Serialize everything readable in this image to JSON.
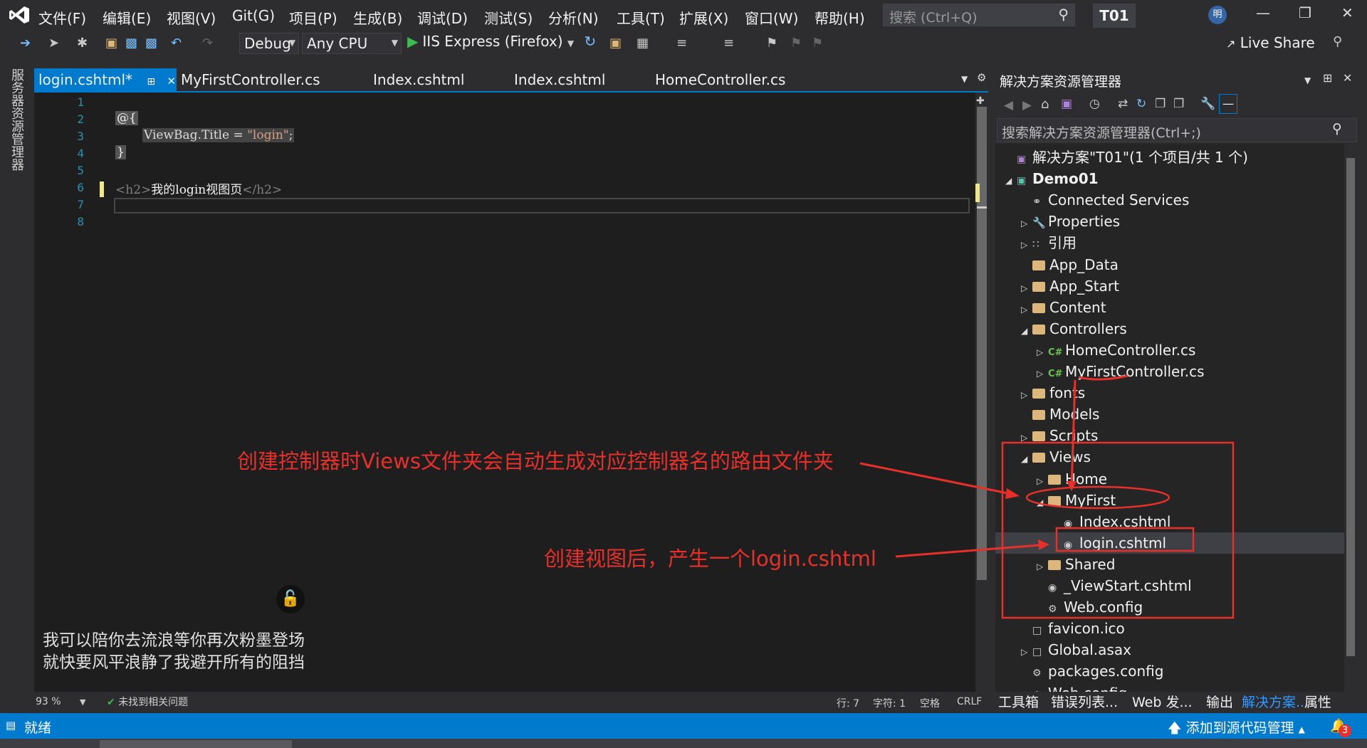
{
  "titlebar": {
    "menus": [
      "文件(F)",
      "编辑(E)",
      "视图(V)",
      "Git(G)",
      "项目(P)",
      "生成(B)",
      "调试(D)",
      "测试(S)",
      "分析(N)",
      "工具(T)",
      "扩展(X)",
      "窗口(W)",
      "帮助(H)"
    ],
    "search_placeholder": "搜索 (Ctrl+Q)",
    "solution_name": "T01",
    "avatar": "明"
  },
  "toolbar": {
    "config": "Debug",
    "platform": "Any CPU",
    "run_label": "IIS Express (Firefox)",
    "live_share": "Live Share"
  },
  "left_strip": "服务器资源管理器",
  "tabs": [
    {
      "label": "login.cshtml*",
      "active": true
    },
    {
      "label": "MyFirstController.cs"
    },
    {
      "label": "Index.cshtml"
    },
    {
      "label": "Index.cshtml"
    },
    {
      "label": "HomeController.cs"
    }
  ],
  "editor": {
    "line_numbers": [
      "1",
      "2",
      "3",
      "4",
      "5",
      "6",
      "7",
      "8"
    ],
    "code": {
      "l2": "@{",
      "l3_a": "ViewBag.Title = ",
      "l3_b": "\"login\"",
      "l3_c": ";",
      "l4": "}",
      "l6_a": "<h2>",
      "l6_b": "我的login视图页",
      "l6_c": "</h2>"
    },
    "zoom": "93 %",
    "issues": "未找到相关问题",
    "row": "行: 7",
    "col": "字符: 1",
    "spaces": "空格",
    "eol": "CRLF"
  },
  "solution_explorer": {
    "title": "解决方案资源管理器",
    "search_placeholder": "搜索解决方案资源管理器(Ctrl+;)",
    "tree": [
      {
        "label": "解决方案\"T01\"(1 个项目/共 1 个)",
        "depth": 0,
        "icon": "solution",
        "arrow": ""
      },
      {
        "label": "Demo01",
        "depth": 0,
        "icon": "project",
        "arrow": "open",
        "bold": true
      },
      {
        "label": "Connected Services",
        "depth": 1,
        "icon": "service",
        "arrow": ""
      },
      {
        "label": "Properties",
        "depth": 1,
        "icon": "wrench",
        "arrow": "closed"
      },
      {
        "label": "引用",
        "depth": 1,
        "icon": "ref",
        "arrow": "closed"
      },
      {
        "label": "App_Data",
        "depth": 1,
        "icon": "folder",
        "arrow": ""
      },
      {
        "label": "App_Start",
        "depth": 1,
        "icon": "folder",
        "arrow": "closed"
      },
      {
        "label": "Content",
        "depth": 1,
        "icon": "folder",
        "arrow": "closed"
      },
      {
        "label": "Controllers",
        "depth": 1,
        "icon": "folder",
        "arrow": "open"
      },
      {
        "label": "HomeController.cs",
        "depth": 2,
        "icon": "cs",
        "arrow": "closed"
      },
      {
        "label": "MyFirstController.cs",
        "depth": 2,
        "icon": "cs",
        "arrow": "closed"
      },
      {
        "label": "fonts",
        "depth": 1,
        "icon": "folder",
        "arrow": "closed"
      },
      {
        "label": "Models",
        "depth": 1,
        "icon": "folder",
        "arrow": ""
      },
      {
        "label": "Scripts",
        "depth": 1,
        "icon": "folder",
        "arrow": "closed"
      },
      {
        "label": "Views",
        "depth": 1,
        "icon": "folder",
        "arrow": "open"
      },
      {
        "label": "Home",
        "depth": 2,
        "icon": "folder",
        "arrow": "closed"
      },
      {
        "label": "MyFirst",
        "depth": 2,
        "icon": "folder",
        "arrow": "open"
      },
      {
        "label": "Index.cshtml",
        "depth": 3,
        "icon": "cshtml",
        "arrow": ""
      },
      {
        "label": "login.cshtml",
        "depth": 3,
        "icon": "cshtml",
        "arrow": "",
        "selected": true
      },
      {
        "label": "Shared",
        "depth": 2,
        "icon": "folder",
        "arrow": "closed"
      },
      {
        "label": "_ViewStart.cshtml",
        "depth": 2,
        "icon": "cshtml",
        "arrow": ""
      },
      {
        "label": "Web.config",
        "depth": 2,
        "icon": "config",
        "arrow": ""
      },
      {
        "label": "favicon.ico",
        "depth": 1,
        "icon": "file",
        "arrow": ""
      },
      {
        "label": "Global.asax",
        "depth": 1,
        "icon": "file",
        "arrow": "closed"
      },
      {
        "label": "packages.config",
        "depth": 1,
        "icon": "config",
        "arrow": ""
      },
      {
        "label": "Web.config",
        "depth": 1,
        "icon": "config",
        "arrow": "closed"
      }
    ]
  },
  "bottom_tabs": [
    "工具箱",
    "错误列表...",
    "Web 发...",
    "输出",
    "解决方案...",
    "属性"
  ],
  "statusbar": {
    "status": "就绪",
    "source_control": "添加到源代码管理",
    "notifications": "3"
  },
  "annotations": {
    "views_note": "创建控制器时Views文件夹会自动生成对应控制器名的路由文件夹",
    "login_note": "创建视图后，产生一个login.cshtml"
  },
  "overlay_lyrics": "我可以陪你去流浪等你再次粉墨登场\n就快要风平浪静了我避开所有的阻挡",
  "colors": {
    "accent": "#007acc",
    "annotation": "#e8302a",
    "editor_bg": "#1e1e1e",
    "chrome_bg": "#2d2d30"
  }
}
